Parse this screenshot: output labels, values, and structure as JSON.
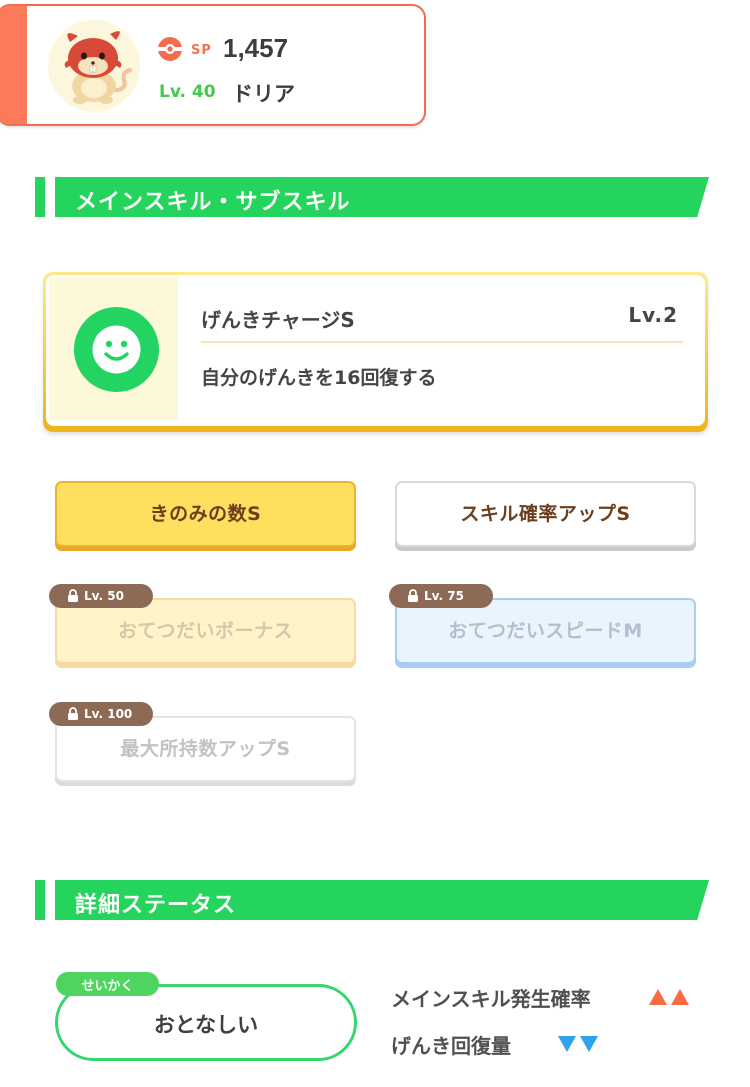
{
  "profile": {
    "sp_label": "SP",
    "sp_value": "1,457",
    "level": "Lv. 40",
    "name": "ドリア",
    "accent_color": "#fa7a5a"
  },
  "sections": {
    "skills_title": "メインスキル・サブスキル",
    "status_title": "詳細ステータス"
  },
  "main_skill": {
    "name": "げんきチャージS",
    "level": "Lv.2",
    "description": "自分のげんきを16回復する",
    "icon": "smiley-face-icon"
  },
  "sub_skills": [
    {
      "label": "きのみの数S",
      "style": "gold",
      "locked": false
    },
    {
      "label": "スキル確率アップS",
      "style": "white",
      "locked": false
    },
    {
      "label": "おてつだいボーナス",
      "style": "gold",
      "locked": true,
      "unlock_level": "Lv. 50"
    },
    {
      "label": "おてつだいスピードM",
      "style": "blue",
      "locked": true,
      "unlock_level": "Lv. 75"
    },
    {
      "label": "最大所持数アップS",
      "style": "white",
      "locked": true,
      "unlock_level": "Lv. 100"
    }
  ],
  "nature": {
    "tag": "せいかく",
    "value": "おとなしい",
    "effects": [
      {
        "label": "メインスキル発生確率",
        "direction": "up",
        "symbol": "▲▲",
        "color": "#f86d3f"
      },
      {
        "label": "げんき回復量",
        "direction": "down",
        "symbol": "▼▼",
        "color": "#2fa2ee"
      }
    ]
  }
}
